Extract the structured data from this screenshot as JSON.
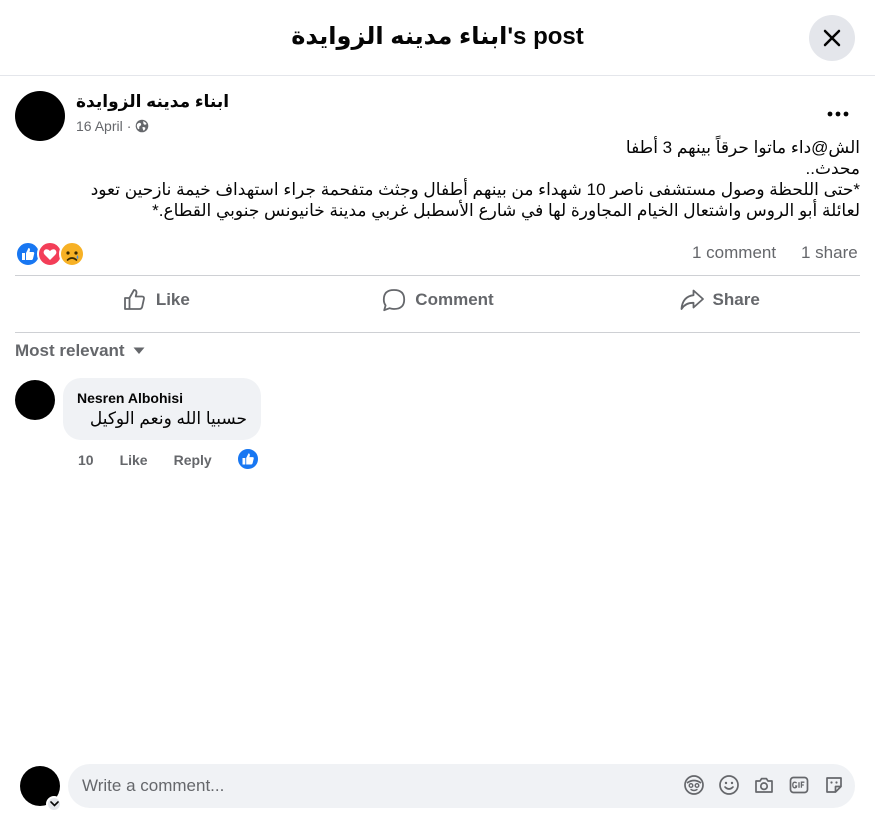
{
  "header": {
    "title": "ابناء مدينه الزوايدة's post"
  },
  "post": {
    "author": "ابناء مدينه الزوايدة",
    "date": "16 April",
    "meta_separator": "·",
    "privacy_icon": "globe-icon",
    "text_lines": [
      "الش@داء ماتوا حرقاً بينهم 3 أطفا",
      "محدث..",
      "*حتى اللحظة وصول مستشفى ناصر 10 شهداء من بينهم أطفال وجثث متفحمة جراء استهداف خيمة نازحين تعود",
      "لعائلة أبو الروس واشتعال الخيام المجاورة لها في شارع الأسطبل غربي مدينة خانيونس جنوبي القطاع.*"
    ],
    "reactions": [
      "like-icon",
      "love-icon",
      "sad-icon"
    ],
    "comment_count": "1 comment",
    "share_count": "1 share"
  },
  "actions": {
    "like": "Like",
    "comment": "Comment",
    "share": "Share"
  },
  "sort": {
    "label": "Most relevant"
  },
  "comment": {
    "author": "Nesren Albohisi",
    "text": "حسبيا الله ونعم الوكيل",
    "time": "10",
    "like": "Like",
    "reply": "Reply",
    "reaction": "like-icon"
  },
  "composer": {
    "placeholder": "Write a comment...",
    "icons": [
      "avatar-sticker-icon",
      "emoji-icon",
      "camera-icon",
      "gif-icon",
      "sticker-icon"
    ]
  },
  "colors": {
    "like_blue": "#1877f2",
    "love_red": "#f33e58",
    "sad_yellow": "#f7b125",
    "muted_text": "#65676b"
  }
}
